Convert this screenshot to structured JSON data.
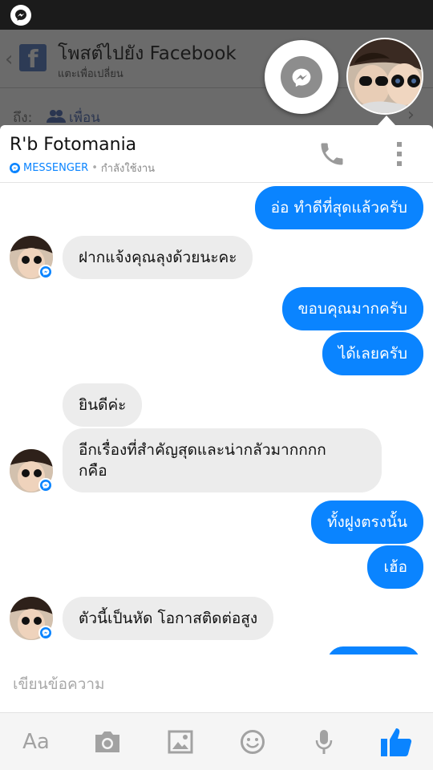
{
  "background_app": {
    "title": "โพสต์ไปยัง Facebook",
    "subtitle": "แตะเพื่อเปลี่ยน",
    "to_label": "ถึง:",
    "audience": "เพื่อน"
  },
  "chat": {
    "name": "R'b Fotomania",
    "app_label": "MESSENGER",
    "separator": "•",
    "status": "กำลังใช้งาน"
  },
  "messages": [
    {
      "direction": "out",
      "text": "อ่อ ทำดีที่สุดแล้วครับ"
    },
    {
      "direction": "in",
      "text": "ฝากแจ้งคุณลุงด้วยนะคะ"
    },
    {
      "direction": "out",
      "text": "ขอบคุณมากครับ"
    },
    {
      "direction": "out",
      "text": "ได้เลยครับ"
    },
    {
      "direction": "in",
      "text": "ยินดีค่ะ"
    },
    {
      "direction": "in",
      "text": "อีกเรื่องที่สำคัญสุดและน่ากลัวมากกกก",
      "text_line2": "กคือ"
    },
    {
      "direction": "out",
      "text": "ทั้งฝูงตรงนั้น"
    },
    {
      "direction": "out",
      "text": "เฮ้อ"
    },
    {
      "direction": "in",
      "text": "ตัวนี้เป็นหัด โอกาสติดต่อสูง"
    }
  ],
  "composer": {
    "placeholder": "เขียนข้อความ"
  },
  "toolbar": {
    "text_format_label": "Aa",
    "icons": [
      "text-format-icon",
      "camera-icon",
      "image-icon",
      "emoji-icon",
      "microphone-icon",
      "thumbs-up-icon"
    ]
  },
  "colors": {
    "accent": "#0a84ff",
    "incoming_bubble": "#ececec",
    "dim_overlay": "#6b6b6b"
  }
}
